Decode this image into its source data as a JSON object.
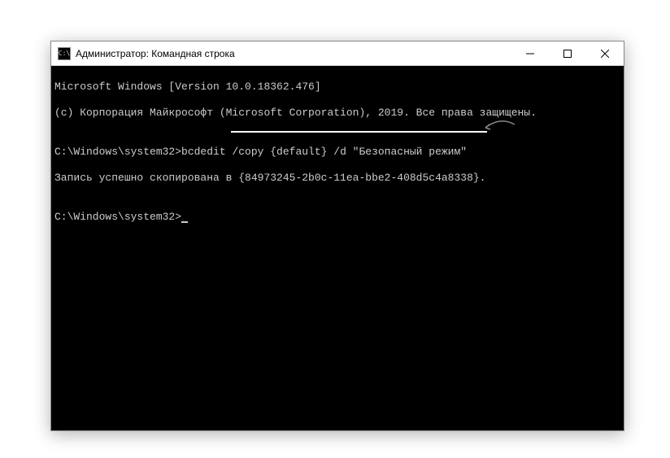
{
  "window": {
    "title": "Администратор: Командная строка",
    "icon_label": "C:\\"
  },
  "terminal": {
    "line1": "Microsoft Windows [Version 10.0.18362.476]",
    "line2": "(c) Корпорация Майкрософт (Microsoft Corporation), 2019. Все права защищены.",
    "blank1": "",
    "prompt1_path": "C:\\Windows\\system32>",
    "command1": "bcdedit /copy {default} /d \"Безопасный режим\"",
    "output1": "Запись успешно скопирована в {84973245-2b0c-11ea-bbe2-408d5c4a8338}.",
    "blank2": "",
    "prompt2_path": "C:\\Windows\\system32>",
    "guid": "{84973245-2b0c-11ea-bbe2-408d5c4a8338}"
  }
}
